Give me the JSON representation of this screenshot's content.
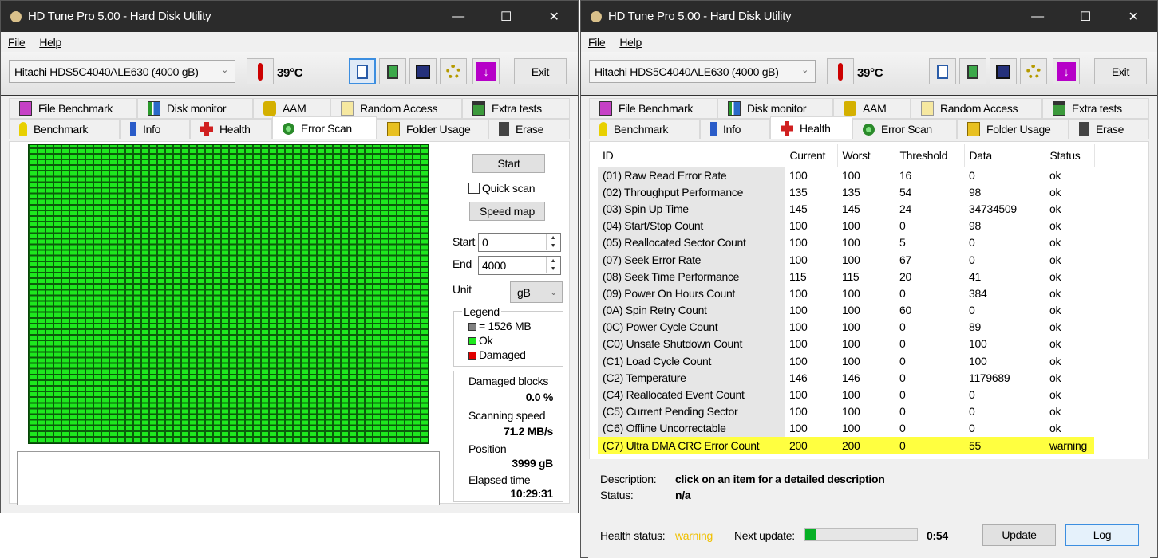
{
  "app_title": "HD Tune Pro 5.00 - Hard Disk Utility",
  "menu": {
    "file": "File",
    "help": "Help"
  },
  "drive": "Hitachi HDS5C4040ALE630 (4000 gB)",
  "temperature": "39°C",
  "exit_label": "Exit",
  "tabs_top": [
    "File Benchmark",
    "Disk monitor",
    "AAM",
    "Random Access",
    "Extra tests"
  ],
  "tabs_bottom": [
    "Benchmark",
    "Info",
    "Health",
    "Error Scan",
    "Folder Usage",
    "Erase"
  ],
  "error_scan": {
    "start_button": "Start",
    "quick_scan": "Quick scan",
    "quick_scan_checked": false,
    "speed_map": "Speed map",
    "start_label": "Start",
    "start_value": "0",
    "end_label": "End",
    "end_value": "4000",
    "unit_label": "Unit",
    "unit_value": "gB",
    "legend_title": "Legend",
    "legend_block": "= 1526 MB",
    "legend_ok": "Ok",
    "legend_damaged": "Damaged",
    "damaged_blocks_label": "Damaged blocks",
    "damaged_blocks": "0.0 %",
    "speed_label": "Scanning speed",
    "speed": "71.2 MB/s",
    "position_label": "Position",
    "position": "3999 gB",
    "elapsed_label": "Elapsed time",
    "elapsed": "10:29:31",
    "colors": {
      "ok": "#1ee81e",
      "damaged": "#e00000",
      "block": "#808080"
    }
  },
  "health": {
    "columns": [
      "ID",
      "Current",
      "Worst",
      "Threshold",
      "Data",
      "Status"
    ],
    "rows": [
      [
        "(01) Raw Read Error Rate",
        "100",
        "100",
        "16",
        "0",
        "ok"
      ],
      [
        "(02) Throughput Performance",
        "135",
        "135",
        "54",
        "98",
        "ok"
      ],
      [
        "(03) Spin Up Time",
        "145",
        "145",
        "24",
        "34734509",
        "ok"
      ],
      [
        "(04) Start/Stop Count",
        "100",
        "100",
        "0",
        "98",
        "ok"
      ],
      [
        "(05) Reallocated Sector Count",
        "100",
        "100",
        "5",
        "0",
        "ok"
      ],
      [
        "(07) Seek Error Rate",
        "100",
        "100",
        "67",
        "0",
        "ok"
      ],
      [
        "(08) Seek Time Performance",
        "115",
        "115",
        "20",
        "41",
        "ok"
      ],
      [
        "(09) Power On Hours Count",
        "100",
        "100",
        "0",
        "384",
        "ok"
      ],
      [
        "(0A) Spin Retry Count",
        "100",
        "100",
        "60",
        "0",
        "ok"
      ],
      [
        "(0C) Power Cycle Count",
        "100",
        "100",
        "0",
        "89",
        "ok"
      ],
      [
        "(C0) Unsafe Shutdown Count",
        "100",
        "100",
        "0",
        "100",
        "ok"
      ],
      [
        "(C1) Load Cycle Count",
        "100",
        "100",
        "0",
        "100",
        "ok"
      ],
      [
        "(C2) Temperature",
        "146",
        "146",
        "0",
        "1179689",
        "ok"
      ],
      [
        "(C4) Reallocated Event Count",
        "100",
        "100",
        "0",
        "0",
        "ok"
      ],
      [
        "(C5) Current Pending Sector",
        "100",
        "100",
        "0",
        "0",
        "ok"
      ],
      [
        "(C6) Offline Uncorrectable",
        "100",
        "100",
        "0",
        "0",
        "ok"
      ],
      [
        "(C7) Ultra DMA CRC Error Count",
        "200",
        "200",
        "0",
        "55",
        "warning"
      ]
    ],
    "description_label": "Description:",
    "description": "click on an item for a detailed description",
    "status_label": "Status:",
    "status": "n/a",
    "health_status_label": "Health status:",
    "health_status": "warning",
    "next_update_label": "Next update:",
    "next_update_progress": 0.1,
    "next_update_time": "0:54",
    "update_button": "Update",
    "log_button": "Log",
    "warning_color": "#f0c000"
  }
}
